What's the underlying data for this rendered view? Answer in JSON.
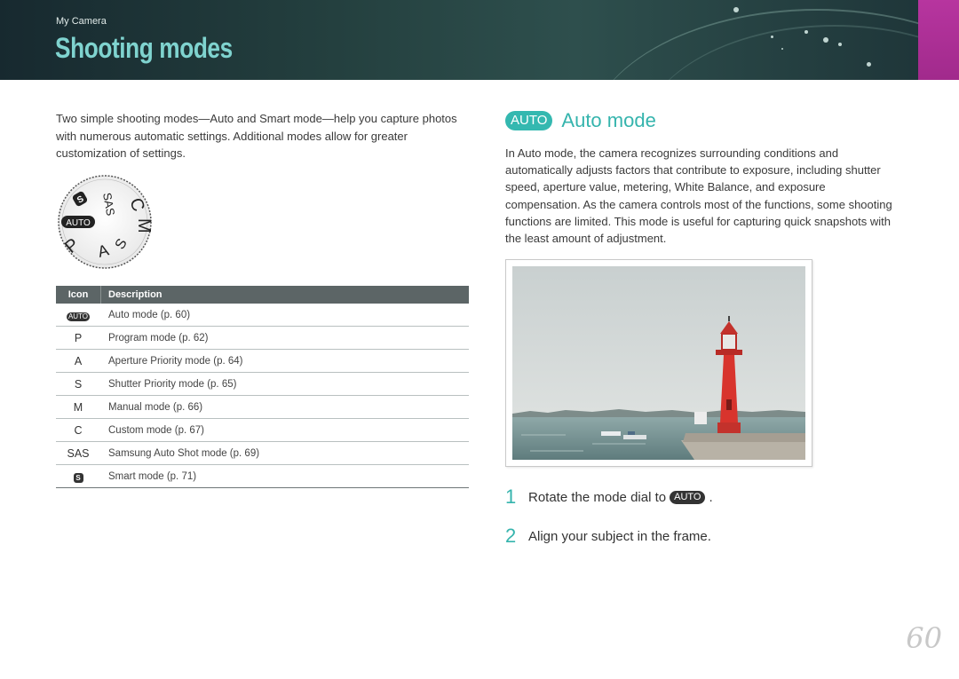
{
  "header": {
    "section_label": "My Camera",
    "title": "Shooting modes"
  },
  "intro": "Two simple shooting modes—Auto and Smart mode—help you capture photos with numerous automatic settings. Additional modes allow for greater customization of settings.",
  "dial": {
    "labels": [
      "AUTO",
      "P",
      "A",
      "S",
      "M",
      "C",
      "SAS",
      "S"
    ]
  },
  "mode_table": {
    "headers": [
      "Icon",
      "Description"
    ],
    "rows": [
      {
        "icon": "AUTO",
        "description": "Auto mode (p. 60)"
      },
      {
        "icon": "P",
        "description": "Program mode (p. 62)"
      },
      {
        "icon": "A",
        "description": "Aperture Priority mode (p. 64)"
      },
      {
        "icon": "S",
        "description": "Shutter Priority mode (p. 65)"
      },
      {
        "icon": "M",
        "description": "Manual mode (p. 66)"
      },
      {
        "icon": "C",
        "description": "Custom mode (p. 67)"
      },
      {
        "icon": "SAS",
        "description": "Samsung Auto Shot mode (p. 69)"
      },
      {
        "icon": "S",
        "description": "Smart mode (p. 71)"
      }
    ]
  },
  "auto_section": {
    "badge": "AUTO",
    "title": "Auto mode",
    "body": "In Auto mode, the camera recognizes surrounding conditions and automatically adjusts factors that contribute to exposure, including shutter speed, aperture value, metering, White Balance, and exposure compensation. As the camera controls most of the functions, some shooting functions are limited. This mode is useful for capturing quick snapshots with the least amount of adjustment."
  },
  "steps": [
    {
      "num": "1",
      "text_before": "Rotate the mode dial to",
      "badge": "AUTO",
      "text_after": "."
    },
    {
      "num": "2",
      "text_before": "Align your subject in the frame.",
      "badge": "",
      "text_after": ""
    }
  ],
  "page_number": "60",
  "colors": {
    "accent": "#35b4ad",
    "header_bg": "#24403f",
    "magenta_tab": "#b7359f"
  }
}
